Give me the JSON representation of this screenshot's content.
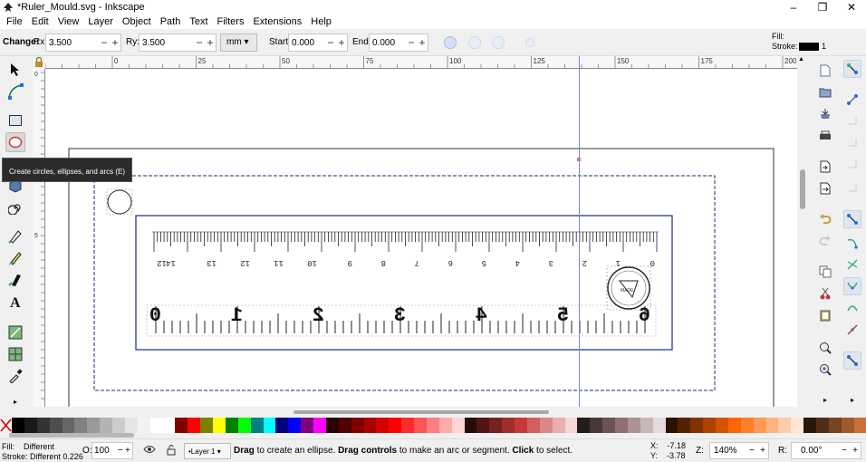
{
  "window": {
    "title": "*Ruler_Mould.svg - Inkscape",
    "controls": [
      "–",
      "❐",
      "✕"
    ]
  },
  "menu": [
    "File",
    "Edit",
    "View",
    "Layer",
    "Object",
    "Path",
    "Text",
    "Filters",
    "Extensions",
    "Help"
  ],
  "toolcontrols": {
    "change_label": "Change:",
    "rx_label": "Rx:",
    "rx_value": "3.500",
    "ry_label": "Ry:",
    "ry_value": "3.500",
    "unit": "mm",
    "start_label": "Start:",
    "start_value": "0.000",
    "end_label": "End:",
    "end_value": "0.000",
    "fill_label": "Fill:",
    "stroke_label": "Stroke:",
    "stroke_width": "1"
  },
  "ruler": {
    "h_labels": [
      "0",
      "25",
      "50",
      "75",
      "100",
      "125",
      "150",
      "175",
      "200"
    ],
    "v_labels": [
      "0",
      "5"
    ]
  },
  "tooltip": "Create circles, ellipses, and arcs (E)",
  "ruler_art": {
    "upper_numbers": [
      "12",
      "14",
      "13",
      "12",
      "11",
      "10",
      "9",
      "8",
      "7",
      "6",
      "5",
      "4",
      "3",
      "2",
      "1",
      "0"
    ],
    "lower_numbers": [
      "0",
      "1",
      "2",
      "3",
      "4",
      "5",
      "6"
    ],
    "logo_text": "MADE"
  },
  "palette": [
    "#000000",
    "#1a1a1a",
    "#333333",
    "#4d4d4d",
    "#666666",
    "#808080",
    "#999999",
    "#b3b3b3",
    "#cccccc",
    "#e6e6e6",
    "#f2f2f2",
    "#ffffff",
    "#ffffff",
    "#800000",
    "#ff0000",
    "#808000",
    "#ffff00",
    "#008000",
    "#00ff00",
    "#008080",
    "#00ffff",
    "#000080",
    "#0000ff",
    "#800080",
    "#ff00ff",
    "#2b0000",
    "#550000",
    "#800000",
    "#aa0000",
    "#d40000",
    "#ff0000",
    "#ff2a2a",
    "#ff5555",
    "#ff8080",
    "#ffaaaa",
    "#ffd5d5",
    "#280b0b",
    "#501616",
    "#782121",
    "#a02c2c",
    "#c83737",
    "#d35f5f",
    "#de8787",
    "#e9afaf",
    "#f4d7d7",
    "#241c1c",
    "#483737",
    "#6c5353",
    "#916f6f",
    "#ac9393",
    "#c8b7b7",
    "#e3dbdb",
    "#2b1100",
    "#552200",
    "#803300",
    "#aa4400",
    "#d45500",
    "#ff6600",
    "#ff7f2a",
    "#ff9955",
    "#ffb380",
    "#ffccaa",
    "#ffe6d5",
    "#28170b",
    "#502d16",
    "#784421",
    "#a05a2c",
    "#c87137"
  ],
  "status": {
    "fill_label": "Fill:",
    "fill_value": "Different",
    "stroke_label": "Stroke:",
    "stroke_value": "Different",
    "stroke_width": "0.226",
    "opacity_label": "O:",
    "opacity_value": "100",
    "layer": "•Layer 1",
    "message_b1": "Drag",
    "message_t1": " to create an ellipse. ",
    "message_b2": "Drag controls",
    "message_t2": " to make an arc or segment. ",
    "message_b3": "Click",
    "message_t3": " to select.",
    "x_label": "X:",
    "x_value": "-7.18",
    "y_label": "Y:",
    "y_value": "-3.78",
    "zoom_label": "Z:",
    "zoom_value": "140%",
    "rotate_label": "R:",
    "rotate_value": "0.00°"
  }
}
